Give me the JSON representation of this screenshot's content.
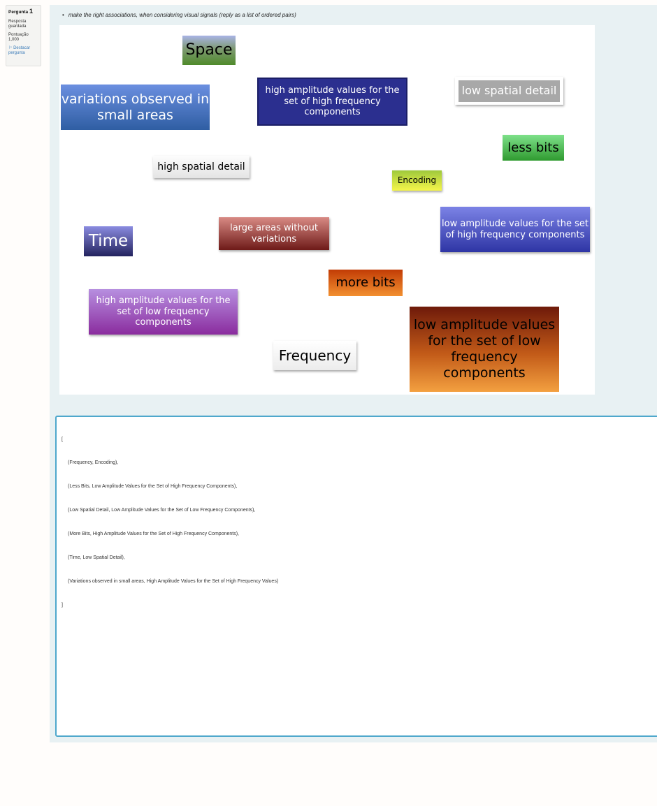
{
  "question_info": {
    "label": "Pergunta",
    "number": "1",
    "status": "Resposta guardada",
    "score_label": "Pontuação",
    "score_value": "1,000",
    "flag_label": "Destacar pergunta",
    "flag_icon": "flag-icon"
  },
  "question": {
    "text": "make the right associations, when considering visual signals (reply as a list of ordered pairs)"
  },
  "tiles": {
    "space": "Space",
    "variations": "variations observed in small areas",
    "high_amp_high_freq": "high amplitude values for the set of high frequency components",
    "low_spatial_detail": "low spatial detail",
    "less_bits": "less bits",
    "high_spatial_detail": "high spatial detail",
    "encoding": "Encoding",
    "low_amp_high_freq": "low amplitude values for the set of high frequency components",
    "time": "Time",
    "large_areas": "large areas without variations",
    "more_bits": "more bits",
    "high_amp_low_freq": "high amplitude values for the set of low frequency components",
    "frequency": "Frequency",
    "low_amp_low_freq": "low amplitude values for the set of low frequency components"
  },
  "answer": {
    "open": "[",
    "lines": [
      "(Frequency, Encoding),",
      "(Less Bits, Low Amplitude Values for the Set of High Frequency Components),",
      "(Low Spatial Detail, Low Amplitude Values for the Set of Low Frequency Components),",
      "(More Bits, High Amplitude Values for the Set of High Frequency Components),",
      "(Time, Low Spatial Detail),",
      "(Variations observed in small areas, High Amplitude Values for the Set of High Frequency Values)"
    ],
    "close": "]"
  }
}
